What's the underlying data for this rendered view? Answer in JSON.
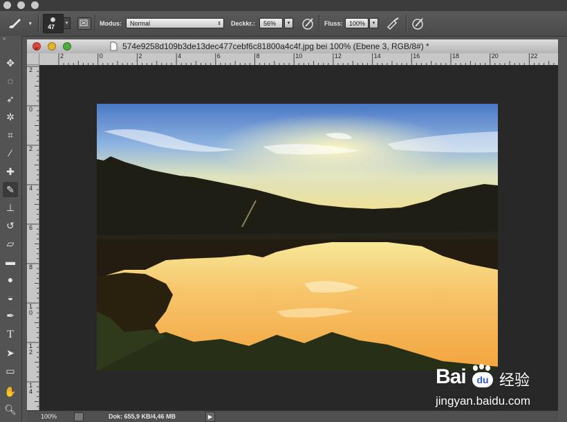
{
  "options_bar": {
    "brush_size": "47",
    "mode_label": "Modus:",
    "mode_value": "Normal",
    "opacity_label": "Deckkr.:",
    "opacity_value": "56%",
    "flow_label": "Fluss:",
    "flow_value": "100%"
  },
  "document": {
    "title": "574e9258d109b3de13dec477cebf6c81800a4c4f.jpg bei 100% (Ebene 3, RGB/8#) *",
    "h_ruler_labels": [
      "2",
      "0",
      "2",
      "4",
      "6",
      "8",
      "10",
      "12",
      "14",
      "16",
      "18",
      "20",
      "22"
    ],
    "v_ruler_labels": [
      "2",
      "0",
      "2",
      "4",
      "6",
      "8",
      "1\n0",
      "1\n2",
      "1\n4"
    ],
    "zoom": "100%",
    "doc_info": "Dok: 655,9 KB/4,46 MB"
  },
  "watermark": {
    "brand": "Bai",
    "paw": "du",
    "cn": "经验",
    "url": "jingyan.baidu.com"
  },
  "colors": {
    "app_bg": "#535353",
    "canvas_bg": "#282828",
    "close": "#e0453c",
    "minimize": "#e2b32c",
    "zoom": "#4cae3a"
  }
}
